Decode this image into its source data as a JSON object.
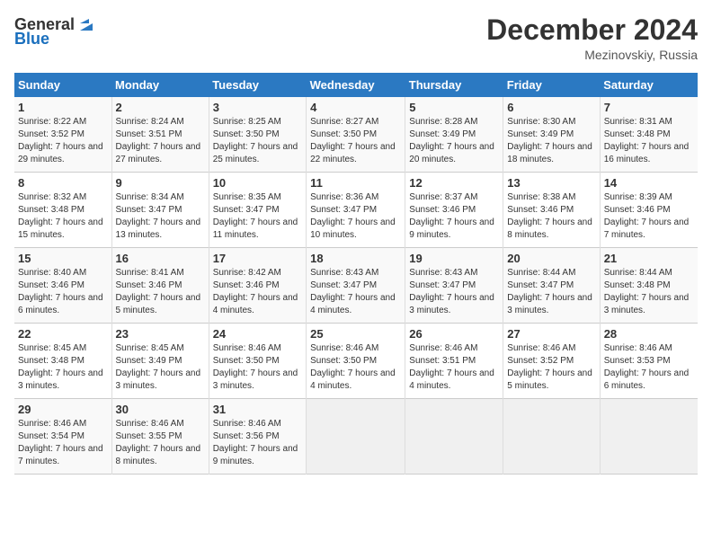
{
  "header": {
    "logo_general": "General",
    "logo_blue": "Blue",
    "month_year": "December 2024",
    "location": "Mezinovskiy, Russia"
  },
  "days_of_week": [
    "Sunday",
    "Monday",
    "Tuesday",
    "Wednesday",
    "Thursday",
    "Friday",
    "Saturday"
  ],
  "weeks": [
    [
      {
        "day": "1",
        "sunrise": "8:22 AM",
        "sunset": "3:52 PM",
        "daylight": "7 hours and 29 minutes."
      },
      {
        "day": "2",
        "sunrise": "8:24 AM",
        "sunset": "3:51 PM",
        "daylight": "7 hours and 27 minutes."
      },
      {
        "day": "3",
        "sunrise": "8:25 AM",
        "sunset": "3:50 PM",
        "daylight": "7 hours and 25 minutes."
      },
      {
        "day": "4",
        "sunrise": "8:27 AM",
        "sunset": "3:50 PM",
        "daylight": "7 hours and 22 minutes."
      },
      {
        "day": "5",
        "sunrise": "8:28 AM",
        "sunset": "3:49 PM",
        "daylight": "7 hours and 20 minutes."
      },
      {
        "day": "6",
        "sunrise": "8:30 AM",
        "sunset": "3:49 PM",
        "daylight": "7 hours and 18 minutes."
      },
      {
        "day": "7",
        "sunrise": "8:31 AM",
        "sunset": "3:48 PM",
        "daylight": "7 hours and 16 minutes."
      }
    ],
    [
      {
        "day": "8",
        "sunrise": "8:32 AM",
        "sunset": "3:48 PM",
        "daylight": "7 hours and 15 minutes."
      },
      {
        "day": "9",
        "sunrise": "8:34 AM",
        "sunset": "3:47 PM",
        "daylight": "7 hours and 13 minutes."
      },
      {
        "day": "10",
        "sunrise": "8:35 AM",
        "sunset": "3:47 PM",
        "daylight": "7 hours and 11 minutes."
      },
      {
        "day": "11",
        "sunrise": "8:36 AM",
        "sunset": "3:47 PM",
        "daylight": "7 hours and 10 minutes."
      },
      {
        "day": "12",
        "sunrise": "8:37 AM",
        "sunset": "3:46 PM",
        "daylight": "7 hours and 9 minutes."
      },
      {
        "day": "13",
        "sunrise": "8:38 AM",
        "sunset": "3:46 PM",
        "daylight": "7 hours and 8 minutes."
      },
      {
        "day": "14",
        "sunrise": "8:39 AM",
        "sunset": "3:46 PM",
        "daylight": "7 hours and 7 minutes."
      }
    ],
    [
      {
        "day": "15",
        "sunrise": "8:40 AM",
        "sunset": "3:46 PM",
        "daylight": "7 hours and 6 minutes."
      },
      {
        "day": "16",
        "sunrise": "8:41 AM",
        "sunset": "3:46 PM",
        "daylight": "7 hours and 5 minutes."
      },
      {
        "day": "17",
        "sunrise": "8:42 AM",
        "sunset": "3:46 PM",
        "daylight": "7 hours and 4 minutes."
      },
      {
        "day": "18",
        "sunrise": "8:43 AM",
        "sunset": "3:47 PM",
        "daylight": "7 hours and 4 minutes."
      },
      {
        "day": "19",
        "sunrise": "8:43 AM",
        "sunset": "3:47 PM",
        "daylight": "7 hours and 3 minutes."
      },
      {
        "day": "20",
        "sunrise": "8:44 AM",
        "sunset": "3:47 PM",
        "daylight": "7 hours and 3 minutes."
      },
      {
        "day": "21",
        "sunrise": "8:44 AM",
        "sunset": "3:48 PM",
        "daylight": "7 hours and 3 minutes."
      }
    ],
    [
      {
        "day": "22",
        "sunrise": "8:45 AM",
        "sunset": "3:48 PM",
        "daylight": "7 hours and 3 minutes."
      },
      {
        "day": "23",
        "sunrise": "8:45 AM",
        "sunset": "3:49 PM",
        "daylight": "7 hours and 3 minutes."
      },
      {
        "day": "24",
        "sunrise": "8:46 AM",
        "sunset": "3:50 PM",
        "daylight": "7 hours and 3 minutes."
      },
      {
        "day": "25",
        "sunrise": "8:46 AM",
        "sunset": "3:50 PM",
        "daylight": "7 hours and 4 minutes."
      },
      {
        "day": "26",
        "sunrise": "8:46 AM",
        "sunset": "3:51 PM",
        "daylight": "7 hours and 4 minutes."
      },
      {
        "day": "27",
        "sunrise": "8:46 AM",
        "sunset": "3:52 PM",
        "daylight": "7 hours and 5 minutes."
      },
      {
        "day": "28",
        "sunrise": "8:46 AM",
        "sunset": "3:53 PM",
        "daylight": "7 hours and 6 minutes."
      }
    ],
    [
      {
        "day": "29",
        "sunrise": "8:46 AM",
        "sunset": "3:54 PM",
        "daylight": "7 hours and 7 minutes."
      },
      {
        "day": "30",
        "sunrise": "8:46 AM",
        "sunset": "3:55 PM",
        "daylight": "7 hours and 8 minutes."
      },
      {
        "day": "31",
        "sunrise": "8:46 AM",
        "sunset": "3:56 PM",
        "daylight": "7 hours and 9 minutes."
      },
      null,
      null,
      null,
      null
    ]
  ]
}
